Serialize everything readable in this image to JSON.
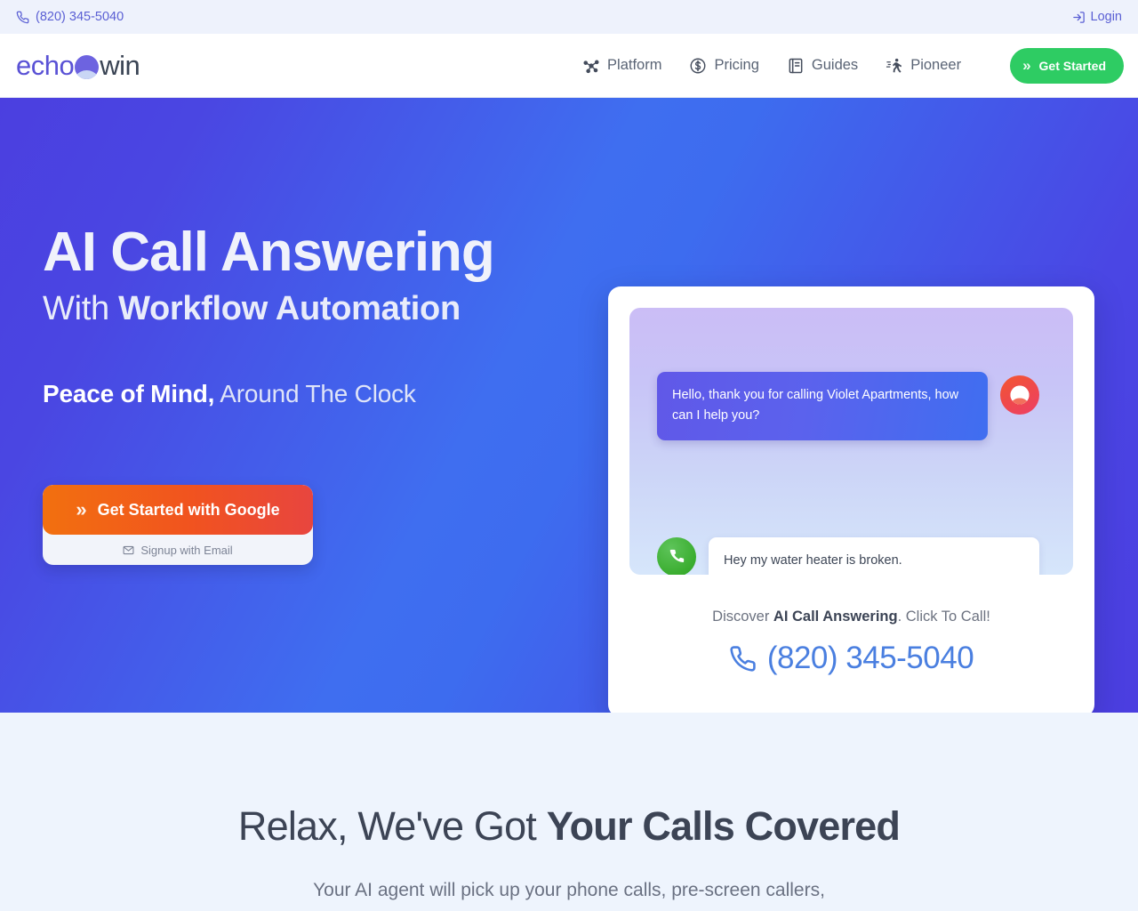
{
  "topbar": {
    "phone": "(820) 345-5040",
    "phone_icon": "phone-icon",
    "login_label": "Login",
    "login_icon": "login-arrow-icon"
  },
  "nav": {
    "logo": {
      "part1": "echo",
      "part2": "win",
      "orb_icon": "echowin-orb-icon"
    },
    "links": [
      {
        "label": "Platform",
        "icon": "network-nodes-icon"
      },
      {
        "label": "Pricing",
        "icon": "dollar-circle-icon"
      },
      {
        "label": "Guides",
        "icon": "book-icon"
      },
      {
        "label": "Pioneer",
        "icon": "runner-icon"
      }
    ],
    "cta": {
      "label": "Get Started",
      "icon": "double-chevron-right-icon",
      "color": "#2ecc63"
    }
  },
  "hero": {
    "headline": "AI Call Answering",
    "subheadline_prefix": "With ",
    "subheadline_bold": "Workflow Automation",
    "tagline_bold": "Peace of Mind,",
    "tagline_rest": " Around The Clock",
    "cta_primary": {
      "label": "Get Started with Google",
      "icon": "double-chevron-right-icon"
    },
    "cta_secondary": {
      "label": "Signup with Email",
      "icon": "envelope-icon"
    },
    "bg_gradient_start": "#4b3fe0",
    "bg_gradient_mid": "#3d6cef",
    "bg_gradient_end": "#4b3ee0"
  },
  "card": {
    "agent_message": "Hello, thank you for calling Violet Apartments, how can I help you?",
    "agent_avatar_icon": "echowin-agent-avatar-icon",
    "user_message": "Hey my water heater is broken.",
    "user_avatar_icon": "green-phone-icon",
    "caption_prefix": "Discover ",
    "caption_bold": "AI Call Answering",
    "caption_suffix": ". Click To Call!",
    "phone": "(820) 345-5040",
    "phone_icon": "phone-icon",
    "phone_color": "#4a7fe0"
  },
  "section2": {
    "title_prefix": "Relax, We've Got ",
    "title_bold": "Your Calls Covered",
    "subtitle_line1": "Your AI agent will pick up your phone calls, pre-screen callers,",
    "bg_color": "#eef4fd"
  }
}
